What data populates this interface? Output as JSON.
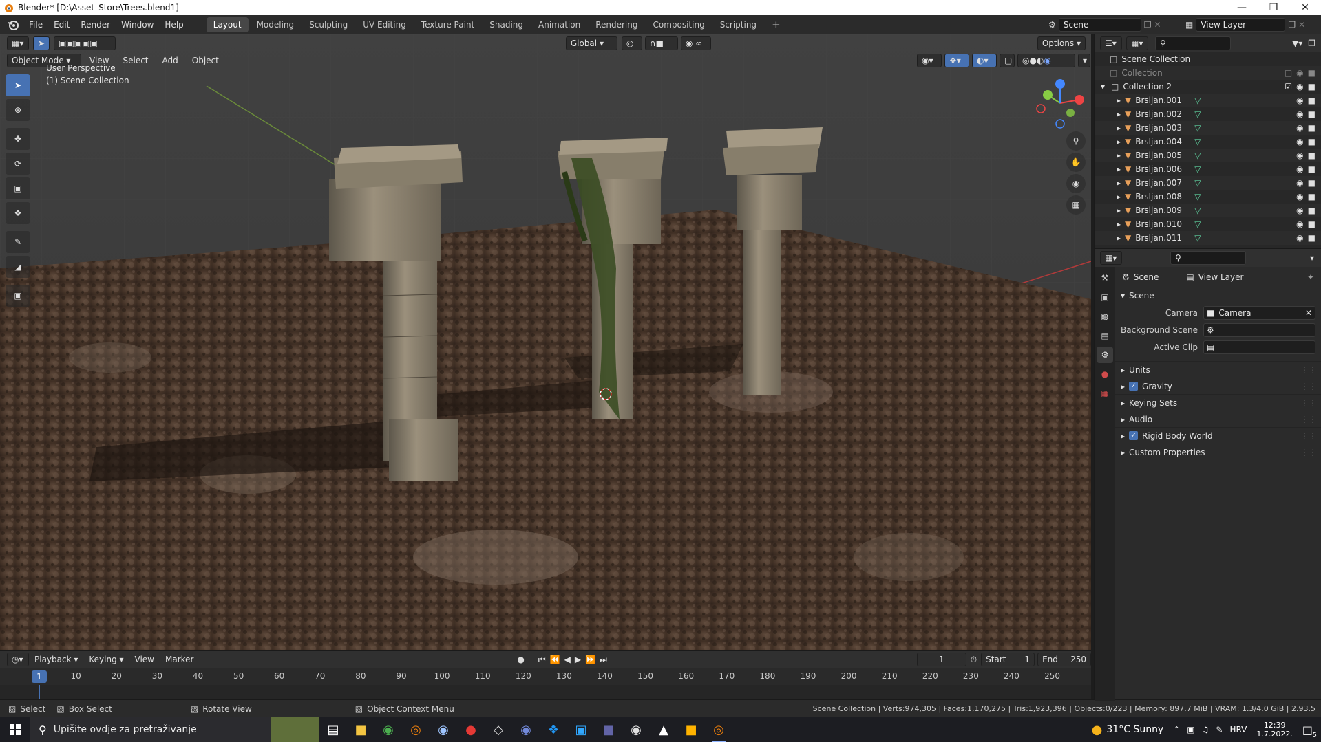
{
  "window": {
    "title": "Blender* [D:\\Asset_Store\\Trees.blend1]",
    "controls": [
      "minimize",
      "restore",
      "close"
    ]
  },
  "menu": [
    "File",
    "Edit",
    "Render",
    "Window",
    "Help"
  ],
  "workspaces": {
    "active": "Layout",
    "tabs": [
      "Layout",
      "Modeling",
      "Sculpting",
      "UV Editing",
      "Texture Paint",
      "Shading",
      "Animation",
      "Rendering",
      "Compositing",
      "Scripting"
    ],
    "add_label": "+"
  },
  "scene_selector": {
    "scene": "Scene",
    "view_layer": "View Layer"
  },
  "viewport": {
    "mode": "Object Mode",
    "menus": [
      "View",
      "Select",
      "Add",
      "Object"
    ],
    "transform_orientation": "Global",
    "options_label": "Options",
    "perspective_label": "User Perspective",
    "collection_label": "(1) Scene Collection",
    "gizmo_axes": [
      "X",
      "Y",
      "Z"
    ]
  },
  "tools": [
    "select-box",
    "cursor",
    "move",
    "rotate",
    "scale",
    "transform",
    "annotate",
    "measure",
    "add-cube"
  ],
  "timeline": {
    "menus": [
      "Playback",
      "Keying",
      "View",
      "Marker"
    ],
    "current_frame": "1",
    "start_label": "Start",
    "start": "1",
    "end_label": "End",
    "end": "250",
    "ticks": [
      "1",
      "10",
      "20",
      "30",
      "40",
      "50",
      "60",
      "70",
      "80",
      "90",
      "100",
      "110",
      "120",
      "130",
      "140",
      "150",
      "160",
      "170",
      "180",
      "190",
      "200",
      "210",
      "220",
      "230",
      "240",
      "250"
    ]
  },
  "status": {
    "select": "Select",
    "box_select": "Box Select",
    "rotate_view": "Rotate View",
    "context_menu": "Object Context Menu",
    "stats": "Scene Collection | Verts:974,305 | Faces:1,170,275 | Tris:1,923,396 | Objects:0/223 | Memory: 897.7 MiB | VRAM: 1.3/4.0 GiB | 2.93.5"
  },
  "outliner": {
    "root": "Scene Collection",
    "collection1": "Collection",
    "collection2": "Collection 2",
    "items": [
      "Brsljan.001",
      "Brsljan.002",
      "Brsljan.003",
      "Brsljan.004",
      "Brsljan.005",
      "Brsljan.006",
      "Brsljan.007",
      "Brsljan.008",
      "Brsljan.009",
      "Brsljan.010",
      "Brsljan.011"
    ]
  },
  "properties": {
    "breadcrumb_scene": "Scene",
    "breadcrumb_view_layer": "View Layer",
    "panel_title": "Scene",
    "camera_label": "Camera",
    "camera_value": "Camera",
    "background_scene_label": "Background Scene",
    "active_clip_label": "Active Clip",
    "subpanels": [
      {
        "label": "Units",
        "checkbox": false
      },
      {
        "label": "Gravity",
        "checkbox": true
      },
      {
        "label": "Keying Sets",
        "checkbox": false
      },
      {
        "label": "Audio",
        "checkbox": false
      },
      {
        "label": "Rigid Body World",
        "checkbox": true
      },
      {
        "label": "Custom Properties",
        "checkbox": false
      }
    ]
  },
  "taskbar": {
    "search_placeholder": "Upišite ovdje za pretraživanje",
    "weather": "31°C  Sunny",
    "language": "HRV",
    "time": "12:39",
    "date": "1.7.2022.",
    "notifications": "5",
    "apps": [
      "task-view",
      "file-explorer",
      "chrome",
      "blender",
      "steam-like",
      "substance",
      "unity",
      "discord",
      "vscode",
      "photoshop",
      "teams",
      "davinci",
      "tiktok-like",
      "app",
      "blender-active"
    ]
  },
  "colors": {
    "accent": "#4772b3",
    "viewport_bg": "#3d3d3d",
    "panel_bg": "#2b2b2b",
    "mesh_icon": "#e8a05a",
    "modifier_icon": "#5fd3a0"
  }
}
